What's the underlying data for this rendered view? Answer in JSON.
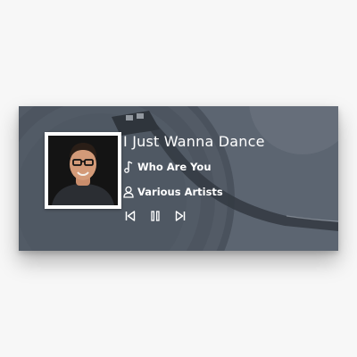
{
  "player": {
    "song_title": "I Just Wanna Dance",
    "album": "Who Are You",
    "artist": "Various Artists"
  },
  "icons": {
    "album": "music-note-icon",
    "artist": "user-icon",
    "previous": "skip-back-icon",
    "pause": "pause-icon",
    "next": "skip-forward-icon"
  },
  "colors": {
    "text": "#ffffff",
    "card_tint": "#6a7380"
  }
}
